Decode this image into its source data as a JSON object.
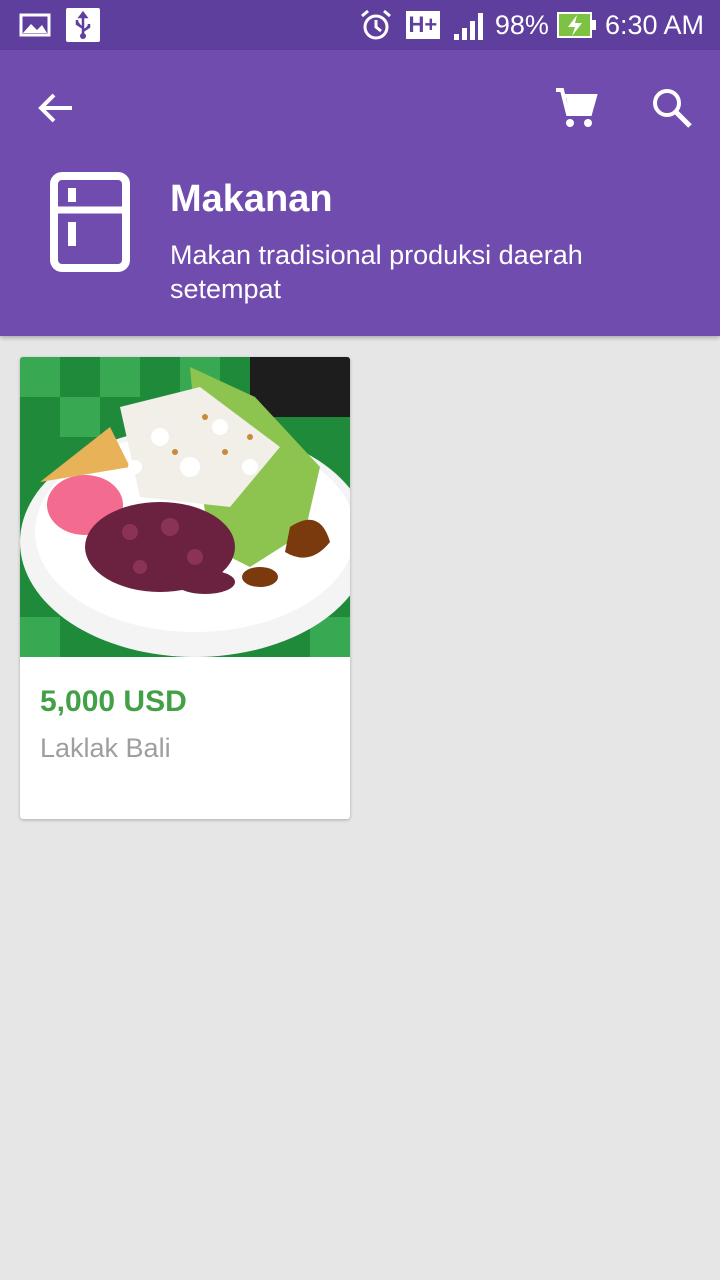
{
  "status_bar": {
    "battery": "98%",
    "time": "6:30 AM",
    "network": "H+"
  },
  "header": {
    "category_title": "Makanan",
    "category_subtitle": "Makan tradisional produksi daerah setempat"
  },
  "products": [
    {
      "price": "5,000 USD",
      "name": "Laklak Bali",
      "image": "food-photo"
    }
  ],
  "colors": {
    "status_bar": "#5e3f9d",
    "app_bar": "#714caf",
    "background": "#e6e6e6",
    "price": "#43a047",
    "product_name": "#9e9e9e"
  }
}
